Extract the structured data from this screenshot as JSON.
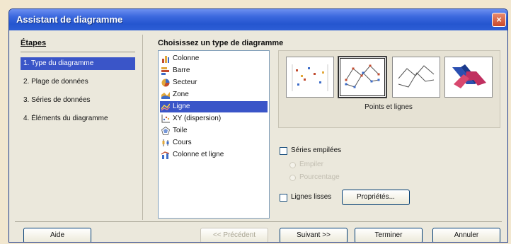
{
  "window": {
    "title": "Assistant de diagramme",
    "close_glyph": "×"
  },
  "steps": {
    "heading": "Étapes",
    "items": [
      {
        "label": "1. Type du diagramme",
        "active": true
      },
      {
        "label": "2. Plage de données",
        "active": false
      },
      {
        "label": "3. Séries de données",
        "active": false
      },
      {
        "label": "4. Éléments du diagramme",
        "active": false
      }
    ]
  },
  "main": {
    "heading": "Choisissez un type de diagramme",
    "chart_types": [
      {
        "label": "Colonne",
        "icon": "column-chart-icon"
      },
      {
        "label": "Barre",
        "icon": "bar-chart-icon"
      },
      {
        "label": "Secteur",
        "icon": "pie-chart-icon"
      },
      {
        "label": "Zone",
        "icon": "area-chart-icon"
      },
      {
        "label": "Ligne",
        "icon": "line-chart-icon",
        "selected": true
      },
      {
        "label": "XY (dispersion)",
        "icon": "xy-scatter-chart-icon"
      },
      {
        "label": "Toile",
        "icon": "net-chart-icon"
      },
      {
        "label": "Cours",
        "icon": "stock-chart-icon"
      },
      {
        "label": "Colonne et ligne",
        "icon": "column-and-line-chart-icon"
      }
    ],
    "variants": [
      {
        "name": "points-only",
        "selected": false
      },
      {
        "name": "points-and-lines",
        "selected": true
      },
      {
        "name": "lines-only",
        "selected": false
      },
      {
        "name": "3d-lines",
        "selected": false
      }
    ],
    "variant_caption": "Points et lignes",
    "stacked_series": {
      "label": "Séries empilées",
      "checked": false
    },
    "stack_options": [
      {
        "label": "Empiler",
        "disabled": true
      },
      {
        "label": "Pourcentage",
        "disabled": true
      }
    ],
    "smooth_lines": {
      "label": "Lignes lisses",
      "checked": false
    },
    "properties_button": "Propriétés..."
  },
  "footer": {
    "help": "Aide",
    "back": "<< Précédent",
    "next": "Suivant >>",
    "finish": "Terminer",
    "cancel": "Annuler"
  },
  "colors": {
    "title_bar": "#2455cf",
    "selection": "#3a55c8",
    "dialog_bg": "#ebe8dc"
  }
}
